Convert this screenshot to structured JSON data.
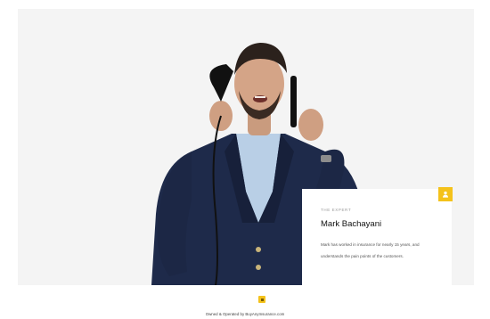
{
  "card": {
    "eyebrow": "THE EXPERT",
    "name": "Mark Bachayani",
    "description": "Mark has worked in insurance for nearly 15 years, and understands the pain points of the customers."
  },
  "badge": {
    "icon": "user-icon",
    "color": "#f4c21b"
  },
  "footer": {
    "icon": "logo-icon",
    "text": "Owned & Operated by BuyAnyInsurance.com"
  },
  "colors": {
    "accent": "#f4c21b",
    "hero_background": "#f4f4f4",
    "jacket": "#1e2a4a",
    "shirt": "#b9cfe6"
  }
}
